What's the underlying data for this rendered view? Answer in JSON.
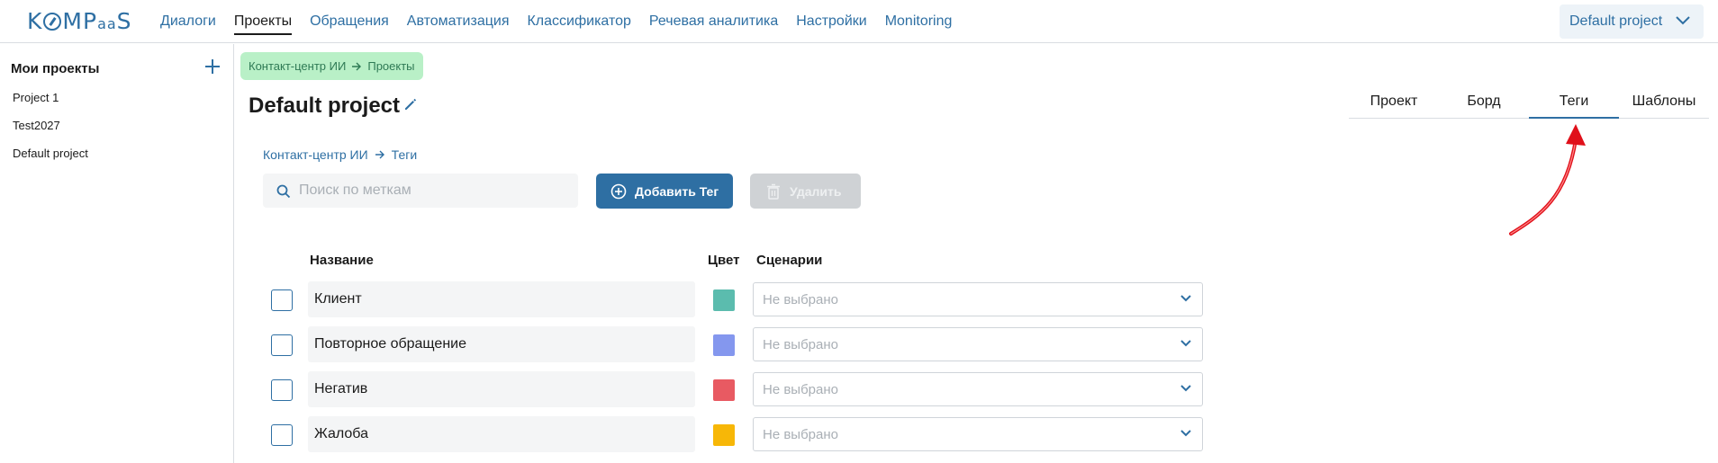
{
  "app": {
    "logo_text": "KOMPaaS"
  },
  "nav": {
    "items": [
      {
        "label": "Диалоги",
        "active": false
      },
      {
        "label": "Проекты",
        "active": true
      },
      {
        "label": "Обращения",
        "active": false
      },
      {
        "label": "Автоматизация",
        "active": false
      },
      {
        "label": "Классификатор",
        "active": false
      },
      {
        "label": "Речевая аналитика",
        "active": false
      },
      {
        "label": "Настройки",
        "active": false
      },
      {
        "label": "Monitoring",
        "active": false
      }
    ],
    "project_selector": "Default project"
  },
  "sidebar": {
    "title": "Мои проекты",
    "items": [
      "Project 1",
      "Test2027",
      "Default project"
    ]
  },
  "breadcrumb": {
    "parts": [
      "Контакт-центр ИИ",
      "Проекты"
    ]
  },
  "page": {
    "title": "Default project"
  },
  "tabs": [
    {
      "label": "Проект",
      "active": false
    },
    {
      "label": "Борд",
      "active": false
    },
    {
      "label": "Теги",
      "active": true
    },
    {
      "label": "Шаблоны",
      "active": false
    }
  ],
  "sub_breadcrumb": {
    "parts": [
      "Контакт-центр ИИ",
      "Теги"
    ]
  },
  "toolbar": {
    "search_placeholder": "Поиск по меткам",
    "add_label": "Добавить Тег",
    "delete_label": "Удалить"
  },
  "table": {
    "headers": {
      "name": "Название",
      "color": "Цвет",
      "scenarios": "Сценарии"
    },
    "rows": [
      {
        "name": "Клиент",
        "color": "#5bbcae",
        "scenarios": "Не выбрано"
      },
      {
        "name": "Повторное обращение",
        "color": "#8497ee",
        "scenarios": "Не выбрано"
      },
      {
        "name": "Негатив",
        "color": "#e85a62",
        "scenarios": "Не выбрано"
      },
      {
        "name": "Жалоба",
        "color": "#f7b707",
        "scenarios": "Не выбрано"
      }
    ]
  },
  "colors": {
    "accent": "#2e6fa3",
    "annotation_arrow": "#e0101a"
  }
}
